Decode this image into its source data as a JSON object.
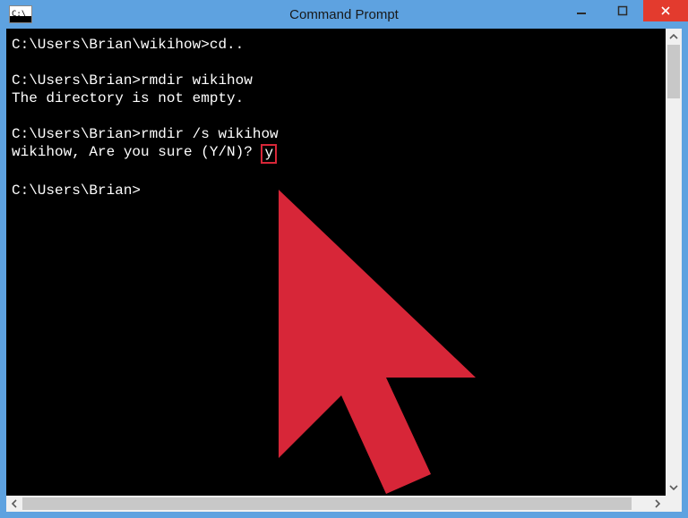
{
  "window": {
    "title": "Command Prompt",
    "icon_label": "C:\\"
  },
  "console": {
    "lines": [
      {
        "prompt": "C:\\Users\\Brian\\wikihow>",
        "cmd": "cd.."
      },
      {
        "blank": ""
      },
      {
        "prompt": "C:\\Users\\Brian>",
        "cmd": "rmdir wikihow"
      },
      {
        "text": "The directory is not empty."
      },
      {
        "blank": ""
      },
      {
        "prompt": "C:\\Users\\Brian>",
        "cmd": "rmdir /s wikihow"
      },
      {
        "text": "wikihow, Are you sure (Y/N)? ",
        "highlight": "y"
      },
      {
        "blank": ""
      },
      {
        "prompt": "C:\\Users\\Brian>",
        "cmd": ""
      }
    ]
  },
  "cursor_overlay": {
    "color": "#d72638"
  }
}
